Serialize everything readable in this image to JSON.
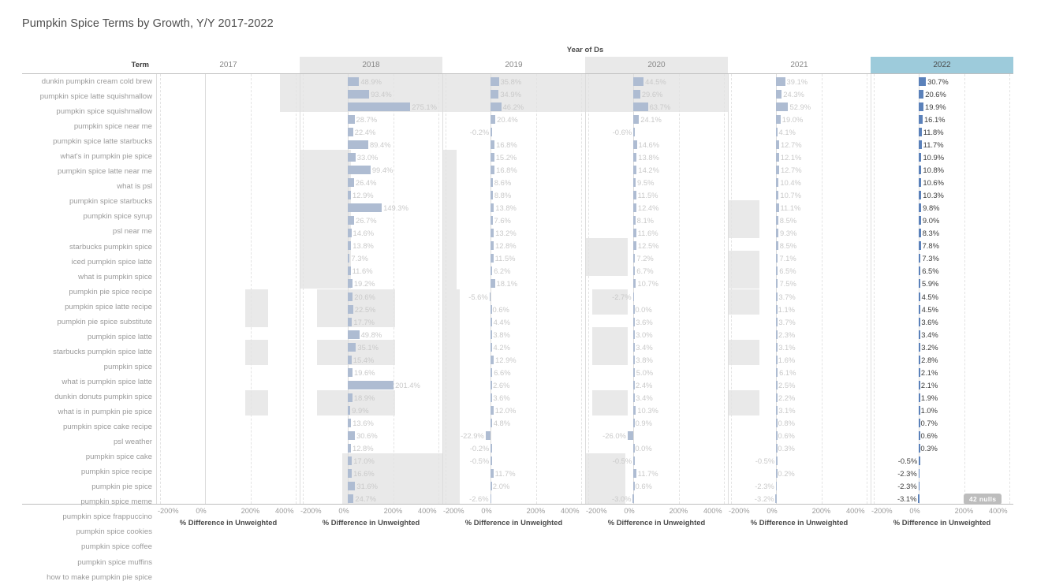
{
  "title": "Pumpkin Spice Terms by Growth, Y/Y 2017-2022",
  "header": {
    "column_group_label": "Year of Ds",
    "term_label": "Term",
    "years": [
      "2017",
      "2018",
      "2019",
      "2020",
      "2021",
      "2022"
    ],
    "selected_year": "2022",
    "selected_color": "#9dcbdb"
  },
  "axis": {
    "title": "% Difference in Unweighted",
    "ticks": [
      "-200%",
      "0%",
      "200%",
      "400%"
    ],
    "min": -200,
    "max": 400
  },
  "nulls_badge": "42 nulls",
  "colors": {
    "bar": "#aebcd2",
    "bar_selected": "#5b81ba",
    "row_shade": "#e9e9e9",
    "label": "#c9c9c9",
    "label_selected": "#3c3c3c"
  },
  "chart_data": {
    "type": "bar",
    "title": "Pumpkin Spice Terms by Growth, Y/Y 2017-2022",
    "xlabel": "% Difference in Unweighted",
    "ylabel": "Term",
    "xlim": [
      -200,
      400
    ],
    "grid": true,
    "legend": "none",
    "categories": [
      "2017",
      "2018",
      "2019",
      "2020",
      "2021",
      "2022"
    ],
    "rows": [
      {
        "term": "dunkin pumpkin cream cold brew",
        "values": [
          null,
          48.9,
          35.8,
          44.5,
          39.1,
          30.7
        ]
      },
      {
        "term": "pumpkin spice latte squishmallow",
        "values": [
          null,
          93.4,
          34.9,
          29.6,
          24.3,
          20.6
        ]
      },
      {
        "term": "pumpkin spice squishmallow",
        "values": [
          null,
          275.1,
          46.2,
          63.7,
          52.9,
          19.9
        ]
      },
      {
        "term": "pumpkin spice near me",
        "values": [
          null,
          28.7,
          20.4,
          24.1,
          19.0,
          16.1
        ]
      },
      {
        "term": "pumpkin spice latte starbucks",
        "values": [
          null,
          22.4,
          -0.2,
          -0.6,
          4.1,
          11.8
        ]
      },
      {
        "term": "what's in pumpkin pie spice",
        "values": [
          null,
          89.4,
          16.8,
          14.6,
          12.7,
          11.7
        ]
      },
      {
        "term": "pumpkin spice latte near me",
        "values": [
          null,
          33.0,
          15.2,
          13.8,
          12.1,
          10.9
        ]
      },
      {
        "term": "what is psl",
        "values": [
          null,
          99.4,
          16.8,
          14.2,
          12.7,
          10.8
        ]
      },
      {
        "term": "pumpkin spice starbucks",
        "values": [
          null,
          26.4,
          8.6,
          9.5,
          10.4,
          10.6
        ]
      },
      {
        "term": "pumpkin spice syrup",
        "values": [
          null,
          12.9,
          8.8,
          11.5,
          10.7,
          10.3
        ]
      },
      {
        "term": "psl near me",
        "values": [
          null,
          149.3,
          13.8,
          12.4,
          11.1,
          9.8
        ]
      },
      {
        "term": "starbucks pumpkin spice",
        "values": [
          null,
          26.7,
          7.6,
          8.1,
          8.5,
          9.0
        ]
      },
      {
        "term": "iced pumpkin spice latte",
        "values": [
          null,
          14.6,
          13.2,
          11.6,
          9.3,
          8.3
        ]
      },
      {
        "term": "what is pumpkin spice",
        "values": [
          null,
          13.8,
          12.8,
          12.5,
          8.5,
          7.8
        ]
      },
      {
        "term": "pumpkin pie spice recipe",
        "values": [
          null,
          7.3,
          11.5,
          7.2,
          7.1,
          7.3
        ]
      },
      {
        "term": "pumpkin spice latte recipe",
        "values": [
          null,
          11.6,
          6.2,
          6.7,
          6.5,
          6.5
        ]
      },
      {
        "term": "pumpkin pie spice substitute",
        "values": [
          null,
          19.2,
          18.1,
          10.7,
          7.5,
          5.9
        ]
      },
      {
        "term": "pumpkin spice latte",
        "values": [
          null,
          20.6,
          -5.6,
          -2.7,
          3.7,
          4.5
        ]
      },
      {
        "term": "starbucks pumpkin spice latte",
        "values": [
          null,
          22.5,
          0.6,
          -0.0,
          1.1,
          4.5
        ]
      },
      {
        "term": "pumpkin spice",
        "values": [
          null,
          17.7,
          4.4,
          3.6,
          3.7,
          3.6
        ]
      },
      {
        "term": "what is pumpkin spice latte",
        "values": [
          null,
          49.8,
          3.8,
          3.0,
          2.3,
          3.4
        ]
      },
      {
        "term": "dunkin donuts pumpkin spice",
        "values": [
          null,
          35.1,
          4.2,
          3.4,
          3.1,
          3.2
        ]
      },
      {
        "term": "what is in pumpkin pie spice",
        "values": [
          null,
          15.4,
          12.9,
          3.8,
          1.6,
          2.8
        ]
      },
      {
        "term": "pumpkin spice cake recipe",
        "values": [
          null,
          19.6,
          6.6,
          5.0,
          6.1,
          2.1
        ]
      },
      {
        "term": "psl weather",
        "values": [
          null,
          201.4,
          2.6,
          2.4,
          2.5,
          2.1
        ]
      },
      {
        "term": "pumpkin spice cake",
        "values": [
          null,
          18.9,
          3.6,
          3.4,
          2.2,
          1.9
        ]
      },
      {
        "term": "pumpkin spice recipe",
        "values": [
          null,
          9.9,
          12.0,
          10.3,
          3.1,
          1.0
        ]
      },
      {
        "term": "pumpkin pie spice",
        "values": [
          null,
          13.6,
          4.8,
          0.9,
          0.8,
          0.7
        ]
      },
      {
        "term": "pumpkin spice meme",
        "values": [
          null,
          30.6,
          -22.9,
          -26.0,
          0.6,
          0.6
        ]
      },
      {
        "term": "pumpkin spice frappuccino",
        "values": [
          null,
          12.8,
          -0.2,
          -0.0,
          0.3,
          0.3
        ]
      },
      {
        "term": "pumpkin spice cookies",
        "values": [
          null,
          17.0,
          -0.5,
          -0.5,
          -0.5,
          -0.5
        ]
      },
      {
        "term": "pumpkin spice coffee",
        "values": [
          null,
          16.6,
          11.7,
          11.7,
          0.2,
          -2.3
        ]
      },
      {
        "term": "pumpkin spice muffins",
        "values": [
          null,
          31.6,
          2.0,
          0.6,
          -2.3,
          -2.3
        ]
      },
      {
        "term": "how to make pumpkin pie spice",
        "values": [
          null,
          24.7,
          -2.6,
          -3.0,
          -3.2,
          -3.1
        ]
      }
    ]
  }
}
